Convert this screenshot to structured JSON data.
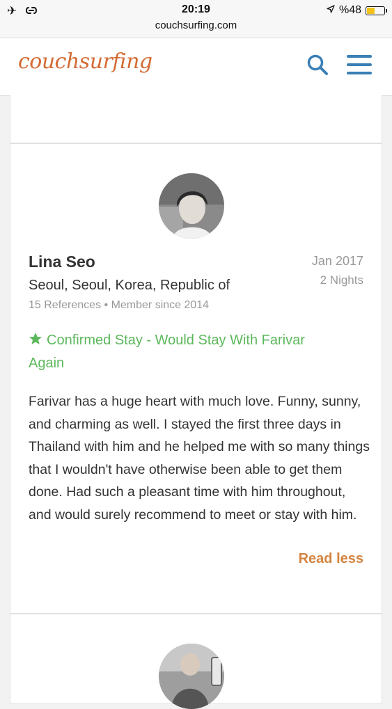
{
  "status_bar": {
    "left_icons": [
      "airplane-icon",
      "link-icon"
    ],
    "time": "20:19",
    "url": "couchsurfing.com",
    "battery_text": "%48",
    "battery_level": 0.48
  },
  "header": {
    "logo": "couchsurfing",
    "brand_color": "#d46b34",
    "accent_color": "#3a7fb5"
  },
  "review": {
    "name": "Lina Seo",
    "location": "Seoul, Seoul, Korea, Republic of",
    "references": "15 References",
    "member_since": "Member since 2014",
    "date": "Jan 2017",
    "nights": "2 Nights",
    "confirmed": "Confirmed Stay - Would Stay With Farivar Again",
    "body": "Farivar has a huge heart with much love. Funny, sunny, and charming as well. I stayed the first three days in Thailand with him and he helped me with so many things that I wouldn't have otherwise been able to get them done. Had such a pleasant time with him throughout, and would surely recommend to meet or stay with him.",
    "read_less": "Read less",
    "confirmed_color": "#5cb85c",
    "read_less_color": "#d4833f"
  }
}
